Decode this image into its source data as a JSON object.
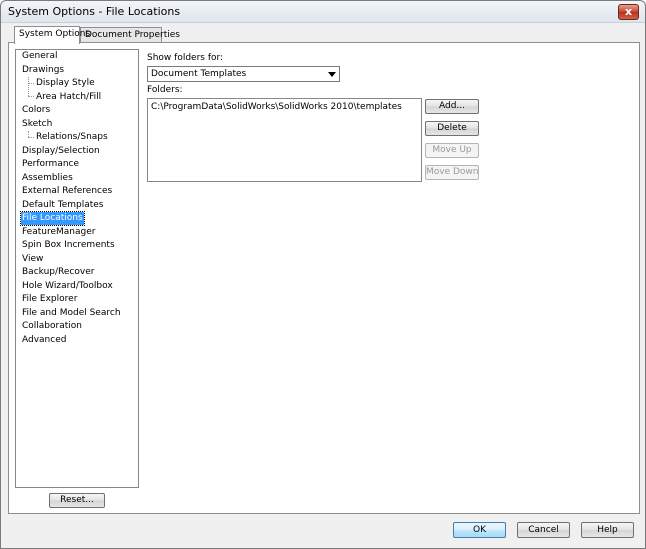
{
  "window": {
    "title": "System Options - File Locations",
    "close_glyph": "x"
  },
  "tabs": [
    {
      "label": "System Options",
      "active": true
    },
    {
      "label": "Document Properties",
      "active": false
    }
  ],
  "tree": {
    "items": [
      {
        "label": "General"
      },
      {
        "label": "Drawings"
      },
      {
        "label": "Display Style",
        "child": true
      },
      {
        "label": "Area Hatch/Fill",
        "child": true
      },
      {
        "label": "Colors"
      },
      {
        "label": "Sketch"
      },
      {
        "label": "Relations/Snaps",
        "child": true
      },
      {
        "label": "Display/Selection"
      },
      {
        "label": "Performance"
      },
      {
        "label": "Assemblies"
      },
      {
        "label": "External References"
      },
      {
        "label": "Default Templates"
      },
      {
        "label": "File Locations",
        "selected": true
      },
      {
        "label": "FeatureManager"
      },
      {
        "label": "Spin Box Increments"
      },
      {
        "label": "View"
      },
      {
        "label": "Backup/Recover"
      },
      {
        "label": "Hole Wizard/Toolbox"
      },
      {
        "label": "File Explorer"
      },
      {
        "label": "File and Model Search"
      },
      {
        "label": "Collaboration"
      },
      {
        "label": "Advanced"
      }
    ],
    "selection_color": "#3399ff"
  },
  "reset_button": "Reset...",
  "show_folders": {
    "label": "Show folders for:",
    "selected": "Document Templates"
  },
  "folders": {
    "label": "Folders:",
    "entries": [
      "C:\\ProgramData\\SolidWorks\\SolidWorks 2010\\templates"
    ]
  },
  "side_buttons": {
    "add": "Add...",
    "delete": "Delete",
    "move_up": "Move Up",
    "move_down": "Move Down"
  },
  "footer": {
    "ok": "OK",
    "cancel": "Cancel",
    "help": "Help"
  }
}
